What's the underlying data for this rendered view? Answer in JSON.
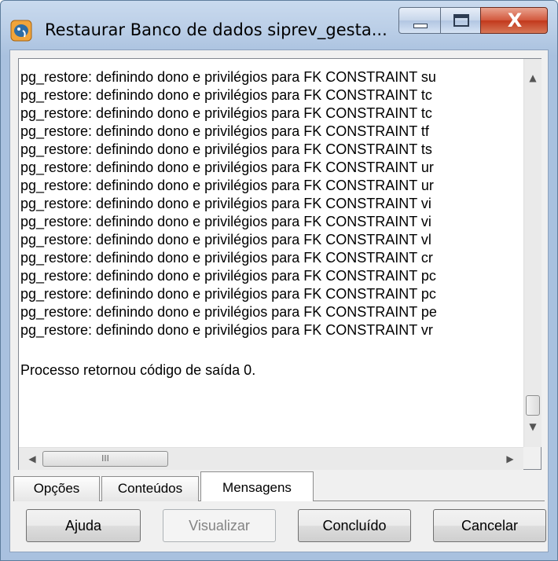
{
  "window": {
    "title": "Restaurar Banco de dados siprev_gesta...",
    "close_glyph": "X"
  },
  "log": {
    "lines": [
      "pg_restore: definindo dono e privilégios para FK CONSTRAINT su",
      "pg_restore: definindo dono e privilégios para FK CONSTRAINT tc",
      "pg_restore: definindo dono e privilégios para FK CONSTRAINT tc",
      "pg_restore: definindo dono e privilégios para FK CONSTRAINT tf",
      "pg_restore: definindo dono e privilégios para FK CONSTRAINT ts",
      "pg_restore: definindo dono e privilégios para FK CONSTRAINT ur",
      "pg_restore: definindo dono e privilégios para FK CONSTRAINT ur",
      "pg_restore: definindo dono e privilégios para FK CONSTRAINT vi",
      "pg_restore: definindo dono e privilégios para FK CONSTRAINT vi",
      "pg_restore: definindo dono e privilégios para FK CONSTRAINT vl",
      "pg_restore: definindo dono e privilégios para FK CONSTRAINT cr",
      "pg_restore: definindo dono e privilégios para FK CONSTRAINT pc",
      "pg_restore: definindo dono e privilégios para FK CONSTRAINT pc",
      "pg_restore: definindo dono e privilégios para FK CONSTRAINT pe",
      "pg_restore: definindo dono e privilégios para FK CONSTRAINT vr"
    ],
    "final_line": "Processo retornou código de saída 0."
  },
  "scrollbar": {
    "hthumb_grip": "III"
  },
  "tabs": [
    {
      "label": "Opções"
    },
    {
      "label": "Conteúdos"
    },
    {
      "label": "Mensagens",
      "active": true
    }
  ],
  "buttons": {
    "help": "Ajuda",
    "view": "Visualizar",
    "done": "Concluído",
    "cancel": "Cancelar"
  },
  "icons": {
    "app": "pgadmin-elephant-icon",
    "minimize": "minimize-icon",
    "maximize": "maximize-icon",
    "close": "close-icon"
  }
}
